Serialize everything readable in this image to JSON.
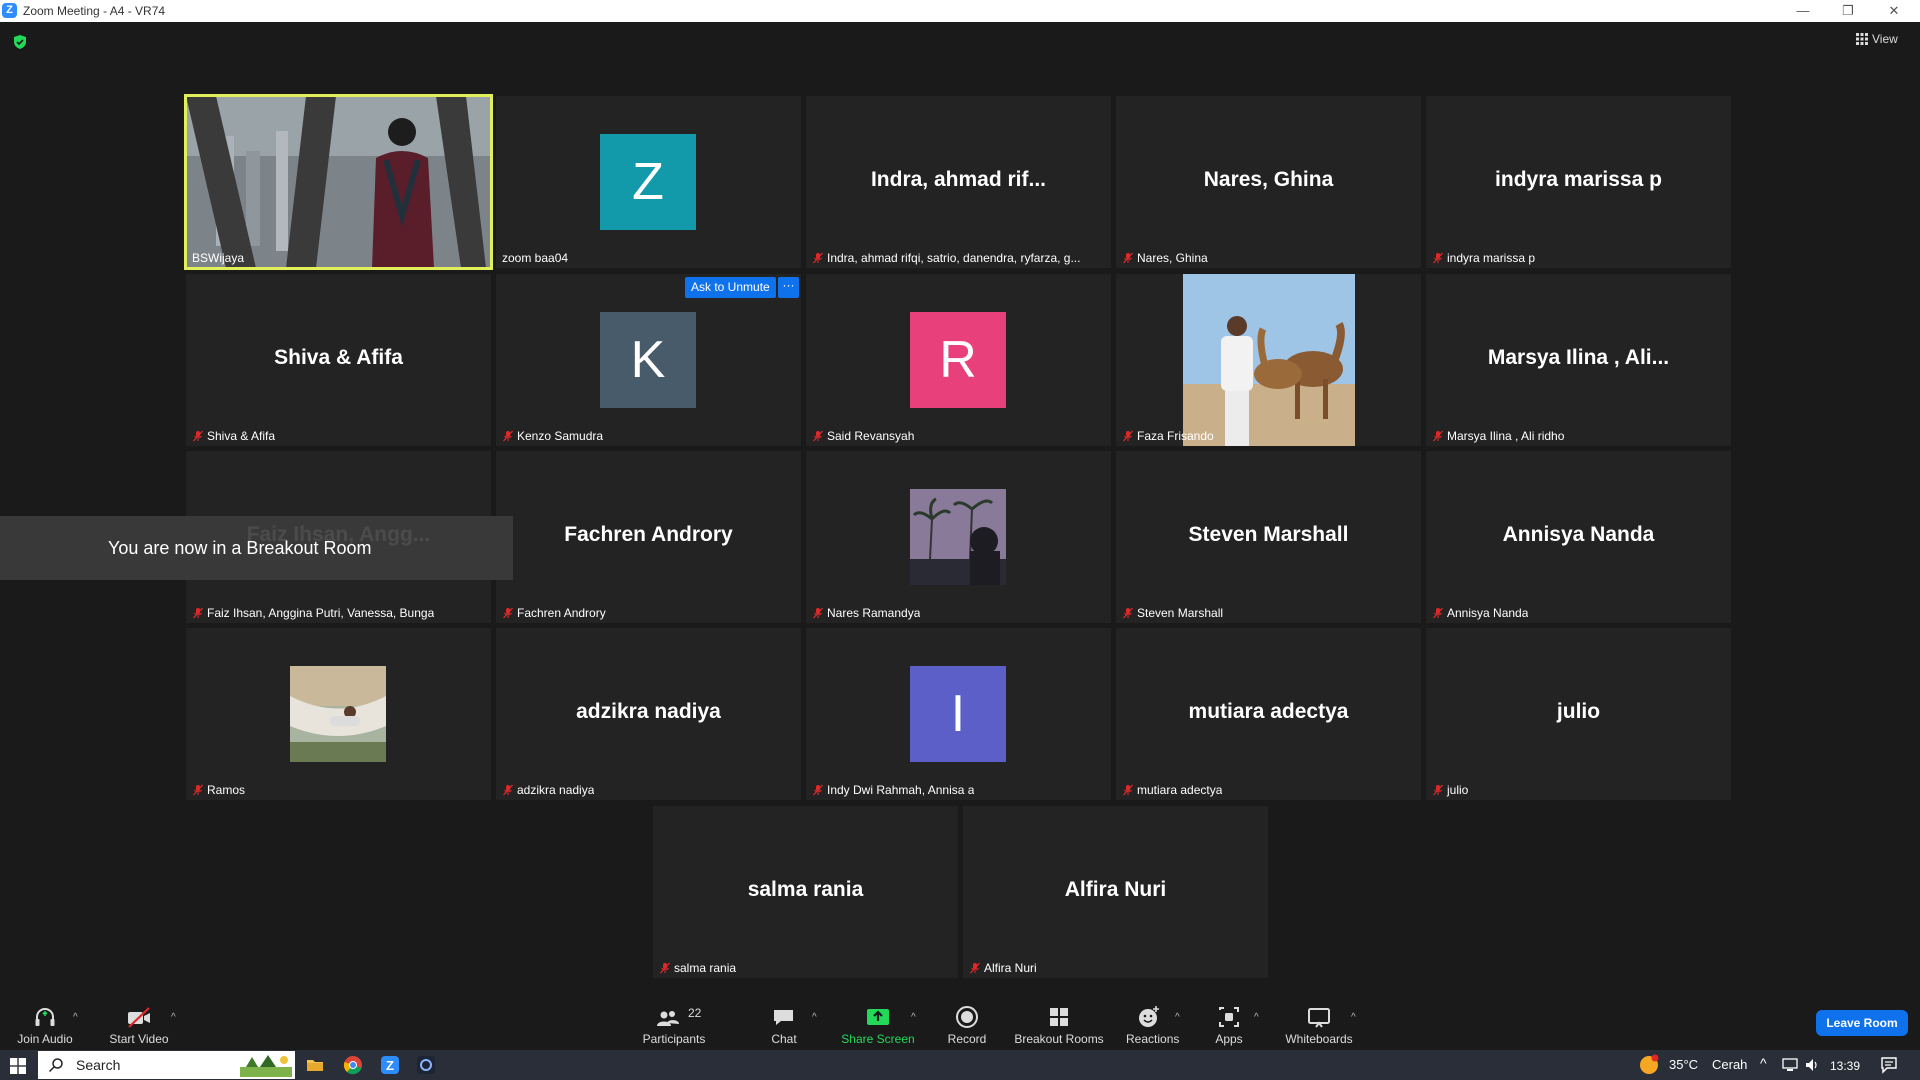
{
  "window": {
    "title": "Zoom Meeting - A4 - VR74",
    "minimize": "—",
    "restore": "❐",
    "close": "✕"
  },
  "view_label": "View",
  "colors": {
    "accent": "#0e72ed",
    "active_speaker": "#e1f05a",
    "share_green": "#23d959",
    "muted_red": "#e02828"
  },
  "participants": [
    {
      "label": "BSWijaya",
      "display": "video",
      "muted": false
    },
    {
      "label": "zoom baa04",
      "display": "avatar",
      "avatar_letter": "Z",
      "avatar_color": "#129aab",
      "muted": false
    },
    {
      "label": "Indra, ahmad rifqi, satrio, danendra, ryfarza, g...",
      "center_name": "Indra, ahmad rif...",
      "display": "name",
      "muted": true
    },
    {
      "label": "Nares, Ghina",
      "center_name": "Nares, Ghina",
      "display": "name",
      "muted": true
    },
    {
      "label": "indyra marissa p",
      "center_name": "indyra marissa p",
      "display": "name",
      "muted": true
    },
    {
      "label": "Shiva & Afifa",
      "center_name": "Shiva & Afifa",
      "display": "name",
      "muted": true
    },
    {
      "label": "Kenzo Samudra",
      "display": "avatar",
      "avatar_letter": "K",
      "avatar_color": "#485b6b",
      "muted": true
    },
    {
      "label": "Said Revansyah",
      "display": "avatar",
      "avatar_letter": "R",
      "avatar_color": "#e8407a",
      "muted": true
    },
    {
      "label": "Faza Frisando",
      "display": "video",
      "muted": true
    },
    {
      "label": "Marsya Ilina , Ali ridho",
      "center_name": "Marsya Ilina , Ali...",
      "display": "name",
      "muted": true
    },
    {
      "label": "Faiz Ihsan, Anggina Putri, Vanessa, Bunga",
      "center_name": "Faiz Ihsan, Angg...",
      "display": "name",
      "muted": true
    },
    {
      "label": "Fachren Androry",
      "center_name": "Fachren Androry",
      "display": "name",
      "muted": true
    },
    {
      "label": "Nares Ramandya",
      "display": "thumb",
      "muted": true
    },
    {
      "label": "Steven Marshall",
      "center_name": "Steven Marshall",
      "display": "name",
      "muted": true
    },
    {
      "label": "Annisya Nanda",
      "center_name": "Annisya Nanda",
      "display": "name",
      "muted": true
    },
    {
      "label": "Ramos",
      "display": "thumb",
      "muted": true
    },
    {
      "label": "adzikra nadiya",
      "center_name": "adzikra nadiya",
      "display": "name",
      "muted": true
    },
    {
      "label": "Indy Dwi Rahmah, Annisa a",
      "display": "avatar",
      "avatar_letter": "I",
      "avatar_color": "#5b5fc7",
      "muted": true
    },
    {
      "label": "mutiara adectya",
      "center_name": "mutiara adectya",
      "display": "name",
      "muted": true
    },
    {
      "label": "julio",
      "center_name": "julio",
      "display": "name",
      "muted": true
    },
    {
      "label": "salma rania",
      "center_name": "salma rania",
      "display": "name",
      "muted": true
    },
    {
      "label": "Alfira Nuri",
      "center_name": "Alfira Nuri",
      "display": "name",
      "muted": true
    }
  ],
  "hover_controls": {
    "ask_to_unmute": "Ask to Unmute",
    "more": "···"
  },
  "toast": "You are now in a Breakout Room",
  "toolbar": {
    "join_audio": "Join Audio",
    "start_video": "Start Video",
    "participants": "Participants",
    "participant_count": "22",
    "chat": "Chat",
    "share_screen": "Share Screen",
    "record": "Record",
    "breakout_rooms": "Breakout Rooms",
    "reactions": "Reactions",
    "apps": "Apps",
    "whiteboards": "Whiteboards",
    "leave": "Leave Room"
  },
  "taskbar": {
    "search": "Search",
    "temperature": "35°C",
    "weather": "Cerah",
    "clock": "13:39"
  }
}
